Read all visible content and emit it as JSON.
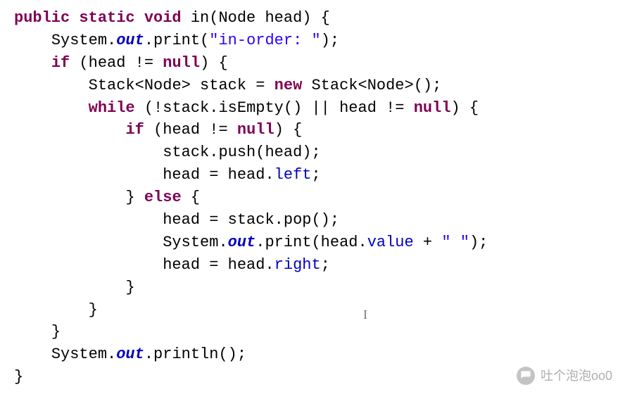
{
  "tokens": {
    "t0": "public static void",
    "t1": " in(Node head) {",
    "t2": "System.",
    "t3": "out",
    "t4": ".print(",
    "t5": "\"in-order: \"",
    "t6": ");",
    "t7": "if",
    "t8": " (head != ",
    "t9": "null",
    "t10": ") {",
    "t11": "Stack<Node> stack = ",
    "t12": "new",
    "t13": " Stack<Node>();",
    "t14": "while",
    "t15": " (!stack.isEmpty() || head != ",
    "t16": "null",
    "t17": ") {",
    "t18": "if",
    "t19": " (head != ",
    "t20": "null",
    "t21": ") {",
    "t22": "stack.push(head);",
    "t23": "head = head.",
    "t24": "left",
    "t25": ";",
    "t26": "} ",
    "t27": "else",
    "t28": " {",
    "t29": "head = stack.pop();",
    "t30": "System.",
    "t31": "out",
    "t32": ".print(head.",
    "t33": "value",
    "t34": " + ",
    "t35": "\" \"",
    "t36": ");",
    "t37": "head = head.",
    "t38": "right",
    "t39": ";",
    "t40": "}",
    "t41": "}",
    "t42": "}",
    "t43": "System.",
    "t44": "out",
    "t45": ".println();",
    "t46": "}"
  },
  "indent": {
    "i0": "",
    "i1": "    ",
    "i2": "        ",
    "i3": "            ",
    "i4": "                "
  },
  "watermark_text": "吐个泡泡oo0"
}
